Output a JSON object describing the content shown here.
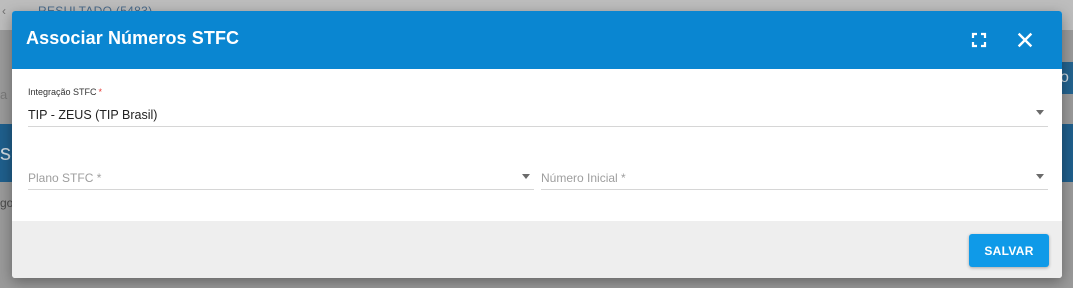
{
  "background": {
    "tab_left": "‹",
    "tab_label": "RESULTADO (5483)",
    "left_text_a": "a",
    "band_text": "se",
    "right_button_text": "o",
    "left_text_go": "go"
  },
  "dialog": {
    "title": "Associar Números STFC",
    "header_icons": [
      "fullscreen-icon",
      "close-icon"
    ],
    "fields": {
      "integracao": {
        "label": "Integração STFC",
        "required_mark": "*",
        "value": "TIP - ZEUS (TIP Brasil)"
      },
      "plano": {
        "placeholder": "Plano STFC *"
      },
      "numero_inicial": {
        "placeholder": "Número Inicial *"
      }
    },
    "save_label": "SALVAR"
  },
  "colors": {
    "header": "#0a86d1",
    "save_button": "#0f9ae8",
    "footer": "#eeeeee",
    "required": "#e53935"
  }
}
